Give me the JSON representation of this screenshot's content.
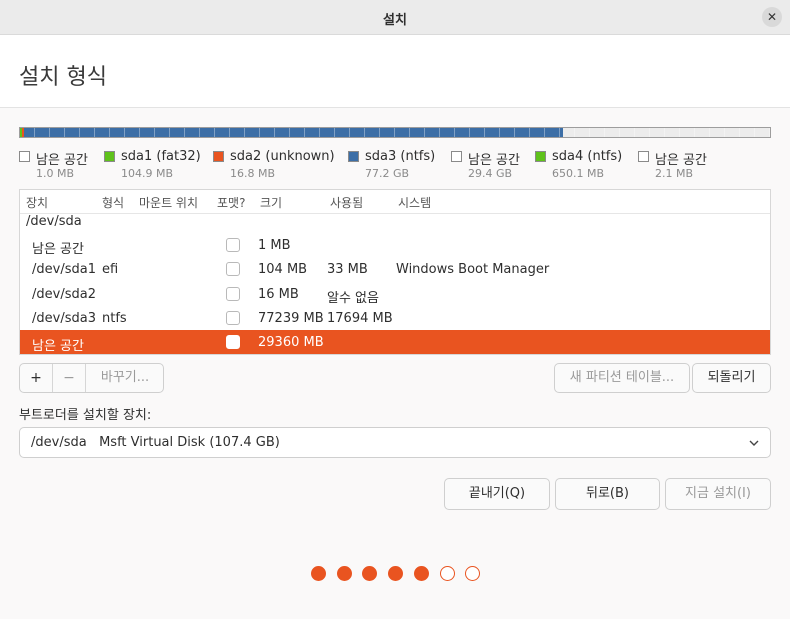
{
  "window": {
    "title": "설치",
    "close_glyph": "✕"
  },
  "page_title": "설치 형식",
  "partition_bar": {
    "segments": [
      {
        "name": "free-1",
        "color": "#ececec",
        "fraction": 1e-05
      },
      {
        "name": "sda1",
        "color": "#5fc21b",
        "fraction": 0.001
      },
      {
        "name": "sda2",
        "color": "#e95420",
        "fraction": 0.0002
      },
      {
        "name": "sda3",
        "color": "#3c6ea6",
        "fraction": 0.7189
      },
      {
        "name": "free-2",
        "color": "#ececec",
        "fraction": 0.2738
      },
      {
        "name": "sda4",
        "color": "#5fc21b",
        "fraction": 0.0061
      },
      {
        "name": "free-3",
        "color": "#ececec",
        "fraction": 2e-05
      }
    ]
  },
  "legend": [
    {
      "name": "남은 공간",
      "size": "1.0 MB",
      "color": "#ffffff"
    },
    {
      "name": "sda1 (fat32)",
      "size": "104.9 MB",
      "color": "#5fc21b"
    },
    {
      "name": "sda2 (unknown)",
      "size": "16.8 MB",
      "color": "#e95420"
    },
    {
      "name": "sda3 (ntfs)",
      "size": "77.2 GB",
      "color": "#3c6ea6"
    },
    {
      "name": "남은 공간",
      "size": "29.4 GB",
      "color": "#ffffff"
    },
    {
      "name": "sda4 (ntfs)",
      "size": "650.1 MB",
      "color": "#5fc21b"
    },
    {
      "name": "남은 공간",
      "size": "2.1 MB",
      "color": "#ffffff"
    }
  ],
  "table": {
    "headers": [
      "장치",
      "형식",
      "마운트 위치",
      "포맷?",
      "크기",
      "사용됨",
      "시스템"
    ],
    "group": "/dev/sda",
    "rows": [
      {
        "device": "남은 공간",
        "type": "",
        "mount": "",
        "size": "1 MB",
        "used": "",
        "system": ""
      },
      {
        "device": "/dev/sda1",
        "type": "efi",
        "mount": "",
        "size": "104 MB",
        "used": "33 MB",
        "system": "Windows Boot Manager"
      },
      {
        "device": "/dev/sda2",
        "type": "",
        "mount": "",
        "size": "16 MB",
        "used": "알수 없음",
        "system": ""
      },
      {
        "device": "/dev/sda3",
        "type": "ntfs",
        "mount": "",
        "size": "77239 MB",
        "used": "17694 MB",
        "system": ""
      },
      {
        "device": "남은 공간",
        "type": "",
        "mount": "",
        "size": "29360 MB",
        "used": "",
        "system": "",
        "selected": true
      }
    ]
  },
  "toolbar": {
    "add": "+",
    "remove": "−",
    "change": "바꾸기...",
    "new_table": "새 파티션 테이블...",
    "revert": "되돌리기"
  },
  "bootloader": {
    "label": "부트로더를 설치할 장치:",
    "value": "/dev/sda   Msft Virtual Disk (107.4 GB)"
  },
  "actions": {
    "quit": "끝내기(Q)",
    "back": "뒤로(B)",
    "install": "지금 설치(I)"
  },
  "progress": {
    "total": 7,
    "done": 5
  }
}
